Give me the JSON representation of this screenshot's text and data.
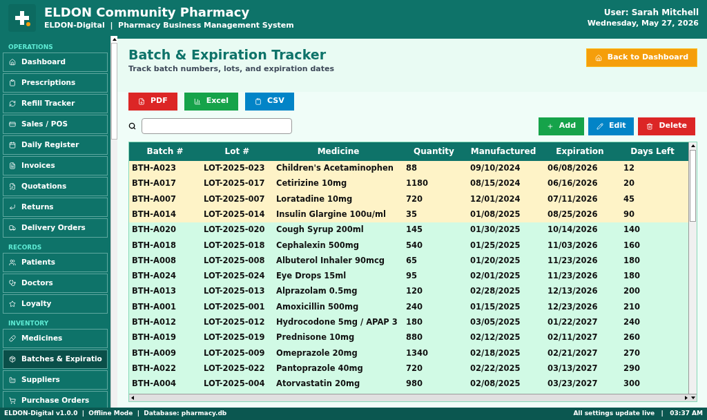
{
  "header": {
    "title": "ELDON Community Pharmacy",
    "subtitle": "ELDON-Digital  |  Pharmacy Business Management System",
    "user": "User: Sarah Mitchell",
    "date": "Wednesday, May 27, 2026"
  },
  "sidebar": {
    "sections": [
      {
        "label": "OPERATIONS",
        "items": [
          {
            "label": "Dashboard",
            "selected": false
          },
          {
            "label": "Prescriptions",
            "selected": false
          },
          {
            "label": "Refill Tracker",
            "selected": false
          },
          {
            "label": "Sales / POS",
            "selected": false
          },
          {
            "label": "Daily Register",
            "selected": false
          },
          {
            "label": "Invoices",
            "selected": false
          },
          {
            "label": "Quotations",
            "selected": false
          },
          {
            "label": "Returns",
            "selected": false
          },
          {
            "label": "Delivery Orders",
            "selected": false
          }
        ]
      },
      {
        "label": "RECORDS",
        "items": [
          {
            "label": "Patients",
            "selected": false
          },
          {
            "label": "Doctors",
            "selected": false
          },
          {
            "label": "Loyalty",
            "selected": false
          }
        ]
      },
      {
        "label": "INVENTORY",
        "items": [
          {
            "label": "Medicines",
            "selected": false
          },
          {
            "label": "Batches & Expiratio",
            "selected": true
          },
          {
            "label": "Suppliers",
            "selected": false
          },
          {
            "label": "Purchase Orders",
            "selected": false
          }
        ]
      }
    ]
  },
  "page": {
    "title": "Batch & Expiration Tracker",
    "subtitle": "Track batch numbers, lots, and expiration dates",
    "back_button": "Back to Dashboard"
  },
  "export_buttons": [
    {
      "label": "PDF",
      "kind": "pdf"
    },
    {
      "label": "Excel",
      "kind": "excel"
    },
    {
      "label": "CSV",
      "kind": "csv"
    }
  ],
  "action_buttons": [
    {
      "label": "Add",
      "kind": "add"
    },
    {
      "label": "Edit",
      "kind": "edit"
    },
    {
      "label": "Delete",
      "kind": "delete"
    }
  ],
  "table": {
    "columns": [
      "Batch #",
      "Lot #",
      "Medicine",
      "Quantity",
      "Manufactured",
      "Expiration",
      "Days Left"
    ],
    "rows": [
      {
        "cells": [
          "BTH-A023",
          "LOT-2025-023",
          "Children's Acetaminophen",
          "88",
          "09/10/2024",
          "06/08/2026",
          "12"
        ],
        "expiring_soon": true
      },
      {
        "cells": [
          "BTH-A017",
          "LOT-2025-017",
          "Cetirizine 10mg",
          "1180",
          "08/15/2024",
          "06/16/2026",
          "20"
        ],
        "expiring_soon": true
      },
      {
        "cells": [
          "BTH-A007",
          "LOT-2025-007",
          "Loratadine 10mg",
          "720",
          "12/01/2024",
          "07/11/2026",
          "45"
        ],
        "expiring_soon": true
      },
      {
        "cells": [
          "BTH-A014",
          "LOT-2025-014",
          "Insulin Glargine 100u/ml",
          "35",
          "01/08/2025",
          "08/25/2026",
          "90"
        ],
        "expiring_soon": true
      },
      {
        "cells": [
          "BTH-A020",
          "LOT-2025-020",
          "Cough Syrup 200ml",
          "145",
          "01/30/2025",
          "10/14/2026",
          "140"
        ],
        "expiring_soon": false
      },
      {
        "cells": [
          "BTH-A018",
          "LOT-2025-018",
          "Cephalexin 500mg",
          "540",
          "01/25/2025",
          "11/03/2026",
          "160"
        ],
        "expiring_soon": false
      },
      {
        "cells": [
          "BTH-A008",
          "LOT-2025-008",
          "Albuterol Inhaler 90mcg",
          "65",
          "01/20/2025",
          "11/23/2026",
          "180"
        ],
        "expiring_soon": false
      },
      {
        "cells": [
          "BTH-A024",
          "LOT-2025-024",
          "Eye Drops 15ml",
          "95",
          "02/01/2025",
          "11/23/2026",
          "180"
        ],
        "expiring_soon": false
      },
      {
        "cells": [
          "BTH-A013",
          "LOT-2025-013",
          "Alprazolam 0.5mg",
          "120",
          "02/28/2025",
          "12/13/2026",
          "200"
        ],
        "expiring_soon": false
      },
      {
        "cells": [
          "BTH-A001",
          "LOT-2025-001",
          "Amoxicillin 500mg",
          "240",
          "01/15/2025",
          "12/23/2026",
          "210"
        ],
        "expiring_soon": false
      },
      {
        "cells": [
          "BTH-A012",
          "LOT-2025-012",
          "Hydrocodone 5mg / APAP 3",
          "180",
          "03/05/2025",
          "01/22/2027",
          "240"
        ],
        "expiring_soon": false
      },
      {
        "cells": [
          "BTH-A019",
          "LOT-2025-019",
          "Prednisone 10mg",
          "880",
          "02/12/2025",
          "02/11/2027",
          "260"
        ],
        "expiring_soon": false
      },
      {
        "cells": [
          "BTH-A009",
          "LOT-2025-009",
          "Omeprazole 20mg",
          "1340",
          "02/18/2025",
          "02/21/2027",
          "270"
        ],
        "expiring_soon": false
      },
      {
        "cells": [
          "BTH-A022",
          "LOT-2025-022",
          "Pantoprazole 40mg",
          "720",
          "02/22/2025",
          "03/13/2027",
          "290"
        ],
        "expiring_soon": false
      },
      {
        "cells": [
          "BTH-A004",
          "LOT-2025-004",
          "Atorvastatin 20mg",
          "980",
          "02/08/2025",
          "03/23/2027",
          "300"
        ],
        "expiring_soon": false
      }
    ]
  },
  "status_bar": {
    "left": "ELDON-Digital v1.0.0  |  Offline Mode  |  Database: pharmacy.db",
    "right": "All settings update live   |   03:37 AM"
  }
}
